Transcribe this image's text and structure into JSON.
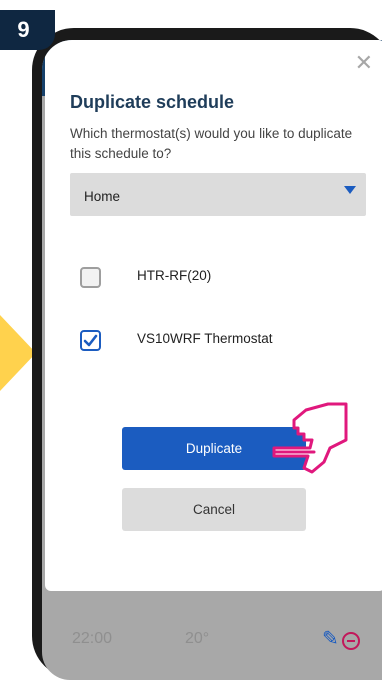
{
  "step": {
    "number": "9"
  },
  "background": {
    "time": "22:00",
    "temp": "20°"
  },
  "dialog": {
    "close": "✕",
    "title": "Duplicate schedule",
    "subtitle": "Which thermostat(s) would you like to duplicate this schedule to?",
    "select": {
      "value": "Home"
    },
    "options": [
      {
        "label": "HTR-RF(20)",
        "checked": false
      },
      {
        "label": "VS10WRF Thermostat",
        "checked": true
      }
    ],
    "primary_button": "Duplicate",
    "secondary_button": "Cancel"
  },
  "colors": {
    "accent": "#1b5cc0",
    "header": "#16416b",
    "badge": "#0f2741",
    "arrow": "#ffd24d",
    "pointer": "#e0187d"
  },
  "icons": {
    "close": "close-icon",
    "caret": "caret-down-icon",
    "check": "check-icon",
    "pointer": "pointing-hand-icon",
    "edit": "pencil-icon",
    "remove": "minus-circle-icon"
  }
}
